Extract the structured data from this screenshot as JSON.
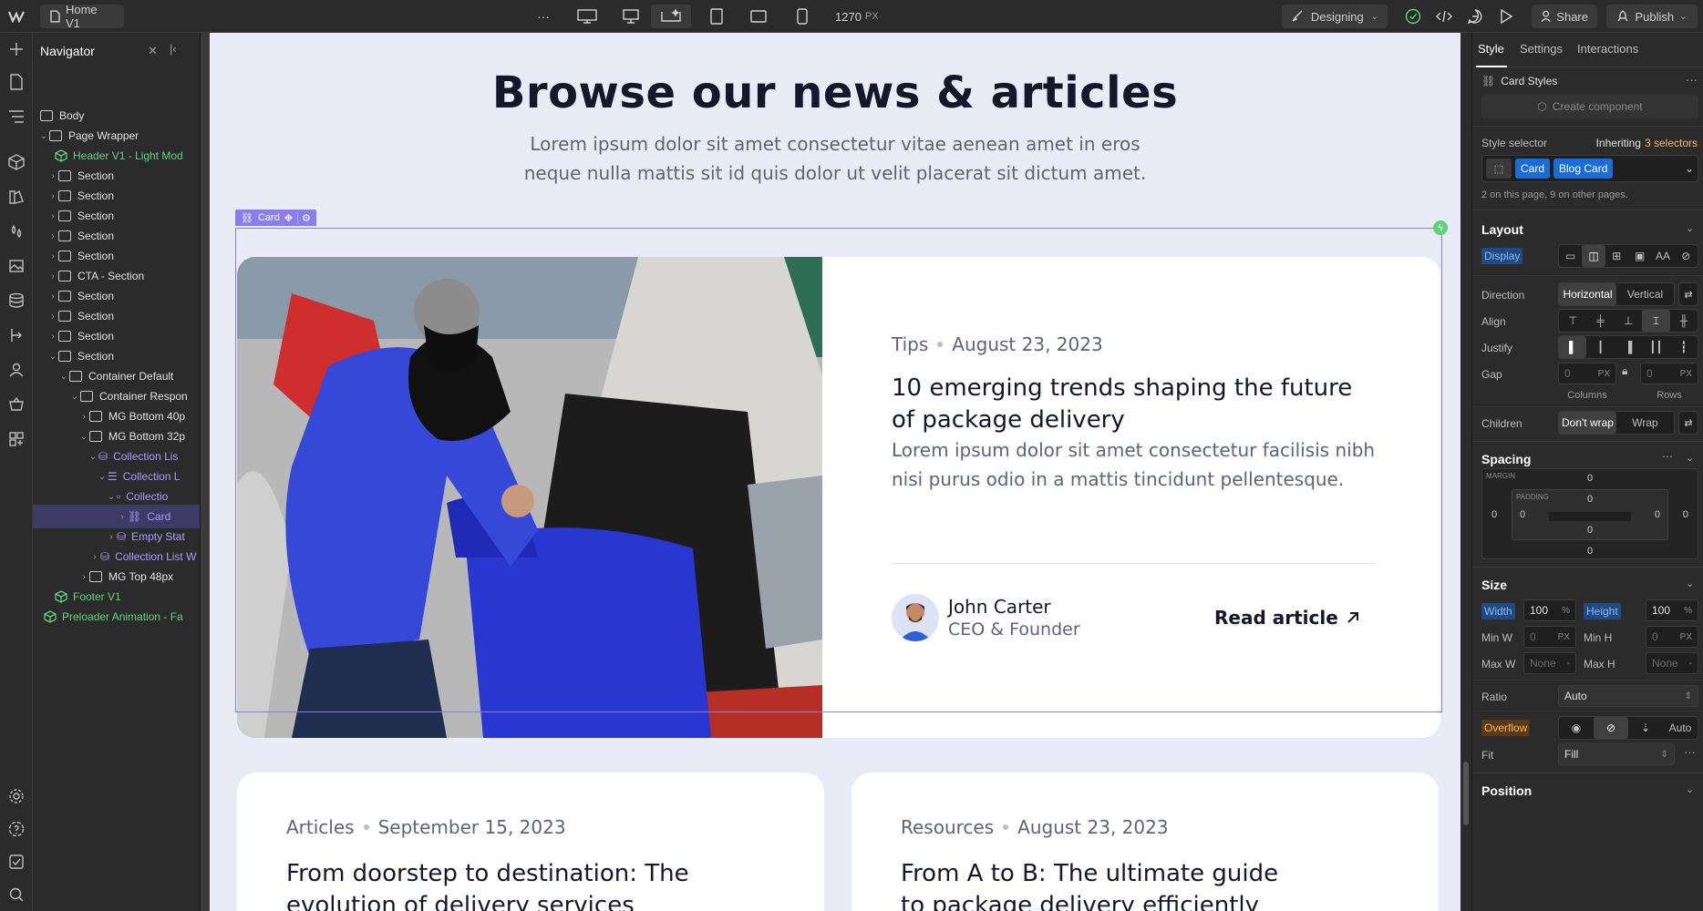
{
  "topbar": {
    "page_name": "Home V1",
    "more": "···",
    "width_readout": "1270",
    "width_unit": "PX",
    "mode_label": "Designing",
    "share_label": "Share",
    "publish_label": "Publish"
  },
  "navigator": {
    "title": "Navigator",
    "items": [
      {
        "label": "Body"
      },
      {
        "label": "Page Wrapper"
      },
      {
        "label": "Header V1 - Light Mod"
      },
      {
        "label": "Section"
      },
      {
        "label": "Section"
      },
      {
        "label": "Section"
      },
      {
        "label": "Section"
      },
      {
        "label": "Section"
      },
      {
        "label": "CTA - Section"
      },
      {
        "label": "Section"
      },
      {
        "label": "Section"
      },
      {
        "label": "Section"
      },
      {
        "label": "Section"
      },
      {
        "label": "Container Default"
      },
      {
        "label": "Container Respon"
      },
      {
        "label": "MG Bottom 40p"
      },
      {
        "label": "MG Bottom 32p"
      },
      {
        "label": "Collection Lis"
      },
      {
        "label": "Collection L"
      },
      {
        "label": "Collectio"
      },
      {
        "label": "Card"
      },
      {
        "label": "Empty Stat"
      },
      {
        "label": "Collection List W"
      },
      {
        "label": "MG Top 48px"
      },
      {
        "label": "Footer V1"
      },
      {
        "label": "Preloader Animation - Fa"
      }
    ]
  },
  "canvas": {
    "heading": "Browse our news & articles",
    "subheading_line1": "Lorem ipsum dolor sit amet consectetur vitae aenean amet in eros",
    "subheading_line2": "neque nulla mattis sit id quis dolor ut velit placerat sit dictum amet.",
    "selection_tag": "Card",
    "featured": {
      "category": "Tips",
      "date": "August 23, 2023",
      "title_line1": "10 emerging trends shaping the future",
      "title_line2": "of package delivery",
      "excerpt_line1": "Lorem ipsum dolor sit amet consectetur facilisis nibh",
      "excerpt_line2": "nisi purus odio in a mattis tincidunt pellentesque.",
      "author_name": "John Carter",
      "author_role": "CEO & Founder",
      "cta": "Read article"
    },
    "cards": [
      {
        "category": "Articles",
        "date": "September 15, 2023",
        "title_line1": "From doorstep to destination: The",
        "title_line2": "evolution of delivery services"
      },
      {
        "category": "Resources",
        "date": "August 23, 2023",
        "title_line1": "From A to B: The ultimate guide",
        "title_line2": "to package delivery efficiently"
      }
    ]
  },
  "right_panel": {
    "tabs": [
      "Style",
      "Settings",
      "Interactions"
    ],
    "active_tab": "Style",
    "card_styles_label": "Card Styles",
    "create_component": "Create component",
    "style_selector_label": "Style selector",
    "inheriting_label": "Inheriting",
    "selectors_count": "3 selectors",
    "selector_chips": [
      "Card",
      "Blog Card"
    ],
    "selector_note": "2 on this page, 9 on other pages.",
    "layout": {
      "title": "Layout",
      "display_label": "Display",
      "direction_label": "Direction",
      "direction_options": [
        "Horizontal",
        "Vertical"
      ],
      "align_label": "Align",
      "justify_label": "Justify",
      "gap_label": "Gap",
      "gap_columns": "0",
      "gap_rows": "0",
      "gap_unit": "PX",
      "columns_label": "Columns",
      "rows_label": "Rows",
      "children_label": "Children",
      "children_options": [
        "Don't wrap",
        "Wrap"
      ]
    },
    "spacing": {
      "title": "Spacing",
      "margin_label": "MARGIN",
      "padding_label": "PADDING",
      "margin_top": "0",
      "margin_right": "0",
      "margin_bottom": "0",
      "margin_left": "0",
      "padding_top": "0",
      "padding_right": "0",
      "padding_bottom": "0",
      "padding_left": "0"
    },
    "size": {
      "title": "Size",
      "width_label": "Width",
      "width_value": "100",
      "width_unit": "%",
      "height_label": "Height",
      "height_value": "100",
      "height_unit": "%",
      "min_w_label": "Min W",
      "min_w_value": "0",
      "min_h_label": "Min H",
      "min_h_value": "0",
      "px": "PX",
      "max_w_label": "Max W",
      "max_w_value": "None",
      "max_h_label": "Max H",
      "max_h_value": "None",
      "dash": "-",
      "ratio_label": "Ratio",
      "ratio_value": "Auto",
      "overflow_label": "Overflow",
      "overflow_auto": "Auto",
      "fit_label": "Fit",
      "fit_value": "Fill"
    },
    "position_title": "Position"
  },
  "colors": {
    "accent_blue": "#1a6dd9",
    "selection_purple": "#8c7cf0",
    "green": "#5fd37c",
    "canvas_bg": "#e9ebf7",
    "jacket_blue": "#3548d8"
  }
}
